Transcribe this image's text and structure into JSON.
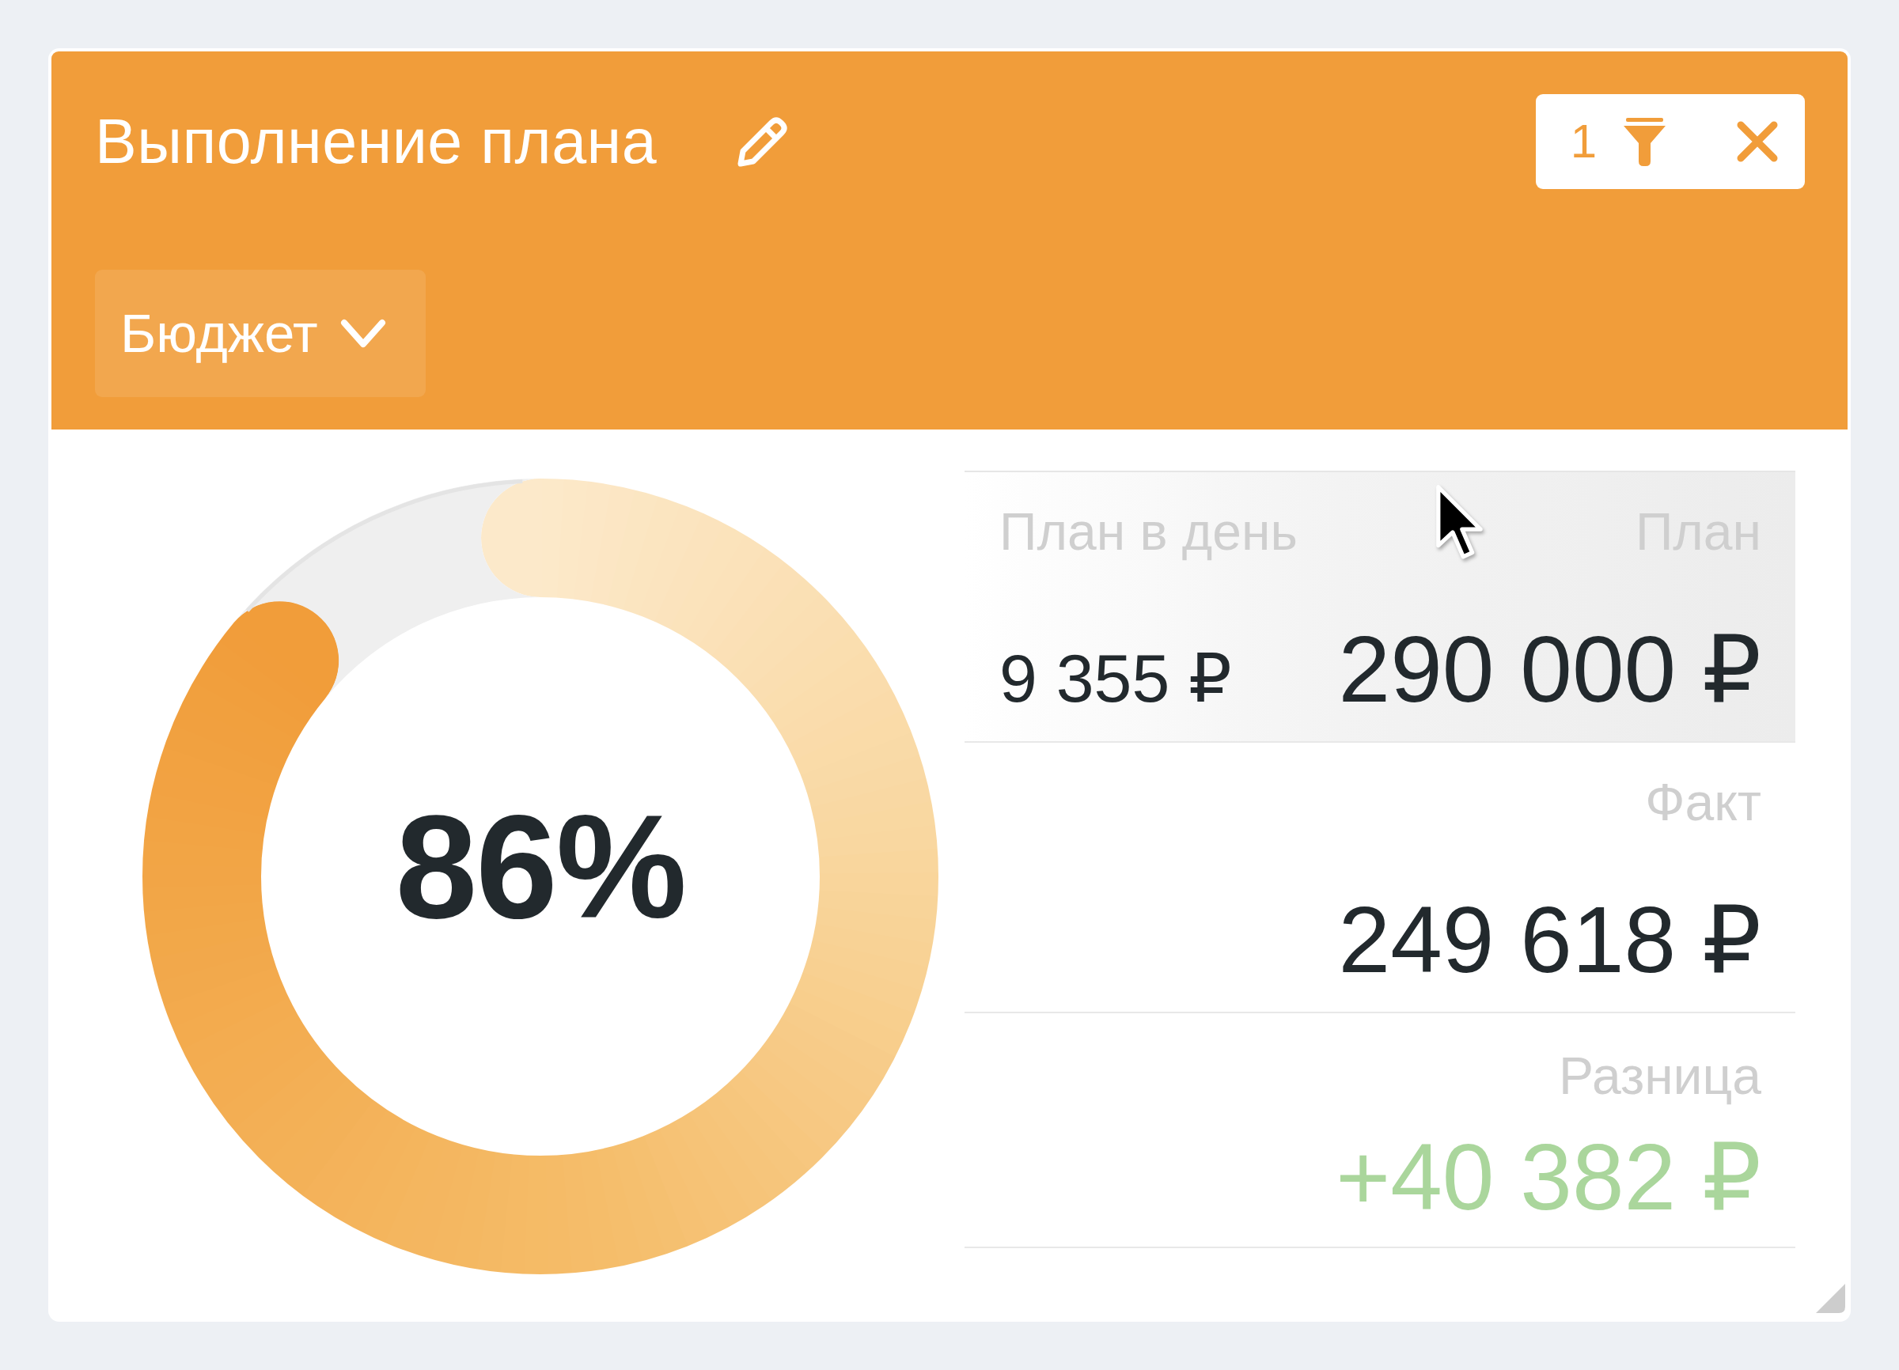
{
  "widget": {
    "title": "Выполнение плана",
    "filter_count": "1",
    "dropdown": {
      "label": "Бюджет"
    }
  },
  "gauge": {
    "level": 0.86,
    "reading": "86%"
  },
  "stats": [
    {
      "highlighted": true,
      "positive": false,
      "secondary": {
        "label": "План в день",
        "value": "9 355 ₽"
      },
      "label": "План",
      "value": "290 000 ₽"
    },
    {
      "highlighted": false,
      "positive": false,
      "label": "Факт",
      "value": "249 618 ₽"
    },
    {
      "highlighted": false,
      "positive": true,
      "label": "Разница",
      "value": "+40 382 ₽"
    }
  ]
}
